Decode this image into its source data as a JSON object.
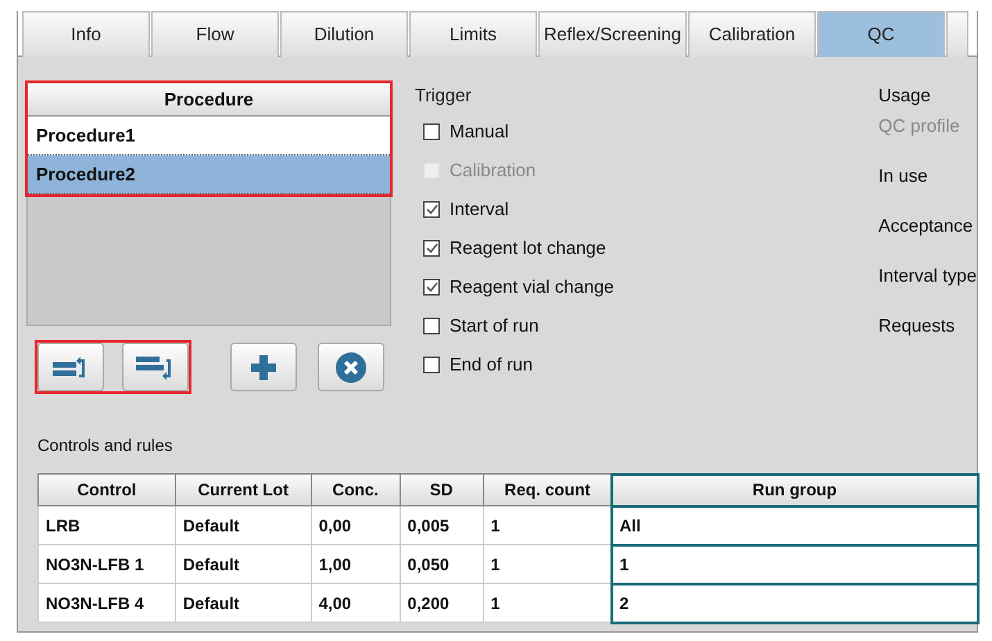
{
  "tabs": [
    {
      "label": "Info",
      "selected": false
    },
    {
      "label": "Flow",
      "selected": false
    },
    {
      "label": "Dilution",
      "selected": false
    },
    {
      "label": "Limits",
      "selected": false
    },
    {
      "label": "Reflex/Screening",
      "selected": false
    },
    {
      "label": "Calibration",
      "selected": false
    },
    {
      "label": "QC",
      "selected": true
    }
  ],
  "procedures": {
    "column": "Procedure",
    "highlighted": true,
    "rows": [
      {
        "name": "Procedure1",
        "selected": false
      },
      {
        "name": "Procedure2",
        "selected": true
      }
    ]
  },
  "procedure_buttons": [
    {
      "kind": "move-up",
      "highlighted": true
    },
    {
      "kind": "move-down",
      "highlighted": true
    },
    {
      "kind": "add",
      "highlighted": false
    },
    {
      "kind": "delete",
      "highlighted": false
    }
  ],
  "trigger": {
    "title": "Trigger",
    "options": [
      {
        "label": "Manual",
        "checked": false,
        "disabled": false
      },
      {
        "label": "Calibration",
        "checked": false,
        "disabled": true
      },
      {
        "label": "Interval",
        "checked": true,
        "disabled": false
      },
      {
        "label": "Reagent lot change",
        "checked": true,
        "disabled": false
      },
      {
        "label": "Reagent vial change",
        "checked": true,
        "disabled": false
      },
      {
        "label": "Start of run",
        "checked": false,
        "disabled": false
      },
      {
        "label": "End of run",
        "checked": false,
        "disabled": false
      }
    ]
  },
  "usage": {
    "title": "Usage",
    "items": [
      {
        "label": "QC profile",
        "disabled": true
      },
      {
        "label": "In use",
        "disabled": false
      },
      {
        "label": "Acceptance",
        "disabled": false
      },
      {
        "label": "Interval type",
        "disabled": false
      },
      {
        "label": "Requests",
        "disabled": false
      }
    ]
  },
  "controls": {
    "title": "Controls and rules",
    "columns": [
      {
        "label": "Control",
        "highlighted": false
      },
      {
        "label": "Current Lot",
        "highlighted": false
      },
      {
        "label": "Conc.",
        "highlighted": false
      },
      {
        "label": "SD",
        "highlighted": false
      },
      {
        "label": "Req. count",
        "highlighted": false
      },
      {
        "label": "Run group",
        "highlighted": true
      }
    ],
    "rows": [
      [
        "LRB",
        "Default",
        "0,00",
        "0,005",
        "1",
        "All"
      ],
      [
        "NO3N-LFB 1",
        "Default",
        "1,00",
        "0,050",
        "1",
        "1"
      ],
      [
        "NO3N-LFB 4",
        "Default",
        "4,00",
        "0,200",
        "1",
        "2"
      ]
    ]
  }
}
